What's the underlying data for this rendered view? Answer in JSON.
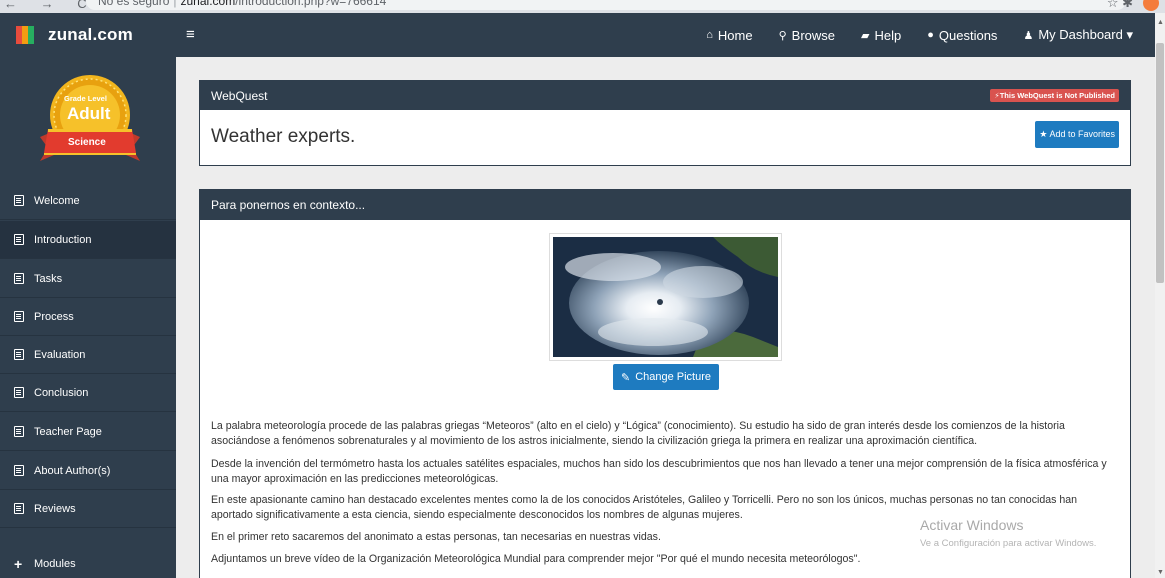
{
  "browser": {
    "nav_glyphs": "← → C",
    "security": "No es seguro",
    "url_host": "zunal.com",
    "url_path": "/introduction.php?w=766614",
    "right_glyphs": "☆ ✱"
  },
  "topbar": {
    "brand": "zunal.com",
    "menu_glyph": "≡",
    "nav": [
      {
        "icon": "home-icon",
        "glyph": "⌂",
        "label": "Home"
      },
      {
        "icon": "search-icon",
        "glyph": "⚲",
        "label": "Browse"
      },
      {
        "icon": "book-icon",
        "glyph": "▰",
        "label": "Help"
      },
      {
        "icon": "comments-icon",
        "glyph": "●",
        "label": "Questions"
      },
      {
        "icon": "user-icon",
        "glyph": "♟",
        "label": "My Dashboard ▾"
      }
    ]
  },
  "badge": {
    "grade_label": "Grade Level",
    "grade_value": "Adult",
    "subject": "Science"
  },
  "sidebar": {
    "items": [
      {
        "label": "Welcome"
      },
      {
        "label": "Introduction"
      },
      {
        "label": "Tasks"
      },
      {
        "label": "Process"
      },
      {
        "label": "Evaluation"
      },
      {
        "label": "Conclusion"
      },
      {
        "label": "Teacher Page"
      },
      {
        "label": "About Author(s)"
      },
      {
        "label": "Reviews"
      }
    ],
    "modules_label": "Modules"
  },
  "webquest": {
    "header": "WebQuest",
    "status_badge": "This WebQuest is Not Published",
    "title": "Weather experts.",
    "favorite_button": "Add to Favorites"
  },
  "intro": {
    "header": "Para ponernos en contexto...",
    "change_picture": "Change Picture",
    "paragraphs": [
      "La palabra meteorología procede de las palabras griegas “Meteoros” (alto en el cielo) y “Lógica” (conocimiento). Su estudio ha sido de gran interés desde los comienzos de la historia asociándose a fenómenos sobrenaturales y al movimiento de los astros inicialmente, siendo la civilización griega la primera en realizar una aproximación científica.",
      "Desde la invención del termómetro hasta los actuales satélites espaciales, muchos han sido los descubrimientos que nos han llevado a tener una mejor comprensión de la física atmosférica y una mayor aproximación en las predicciones meteorológicas.",
      "En este apasionante camino han destacado excelentes mentes como la de los conocidos Aristóteles, Galileo y Torricelli. Pero no son los únicos, muchas personas no tan conocidas han aportado significativamente a esta ciencia, siendo especialmente desconocidos los nombres de algunas mujeres.",
      "En el primer reto sacaremos del anonimato a estas personas, tan necesarias en nuestras vidas.",
      "Adjuntamos un breve vídeo de la Organización Meteorológica Mundial para comprender mejor \"Por qué el mundo necesita meteorólogos\"."
    ]
  },
  "watermark": {
    "title": "Activar Windows",
    "subtitle": "Ve a Configuración para activar Windows."
  },
  "colors": {
    "navbar": "#2f3e4d",
    "primary_button": "#1e7bc0",
    "danger_badge": "#d9534f",
    "page_bg": "#ededed"
  }
}
